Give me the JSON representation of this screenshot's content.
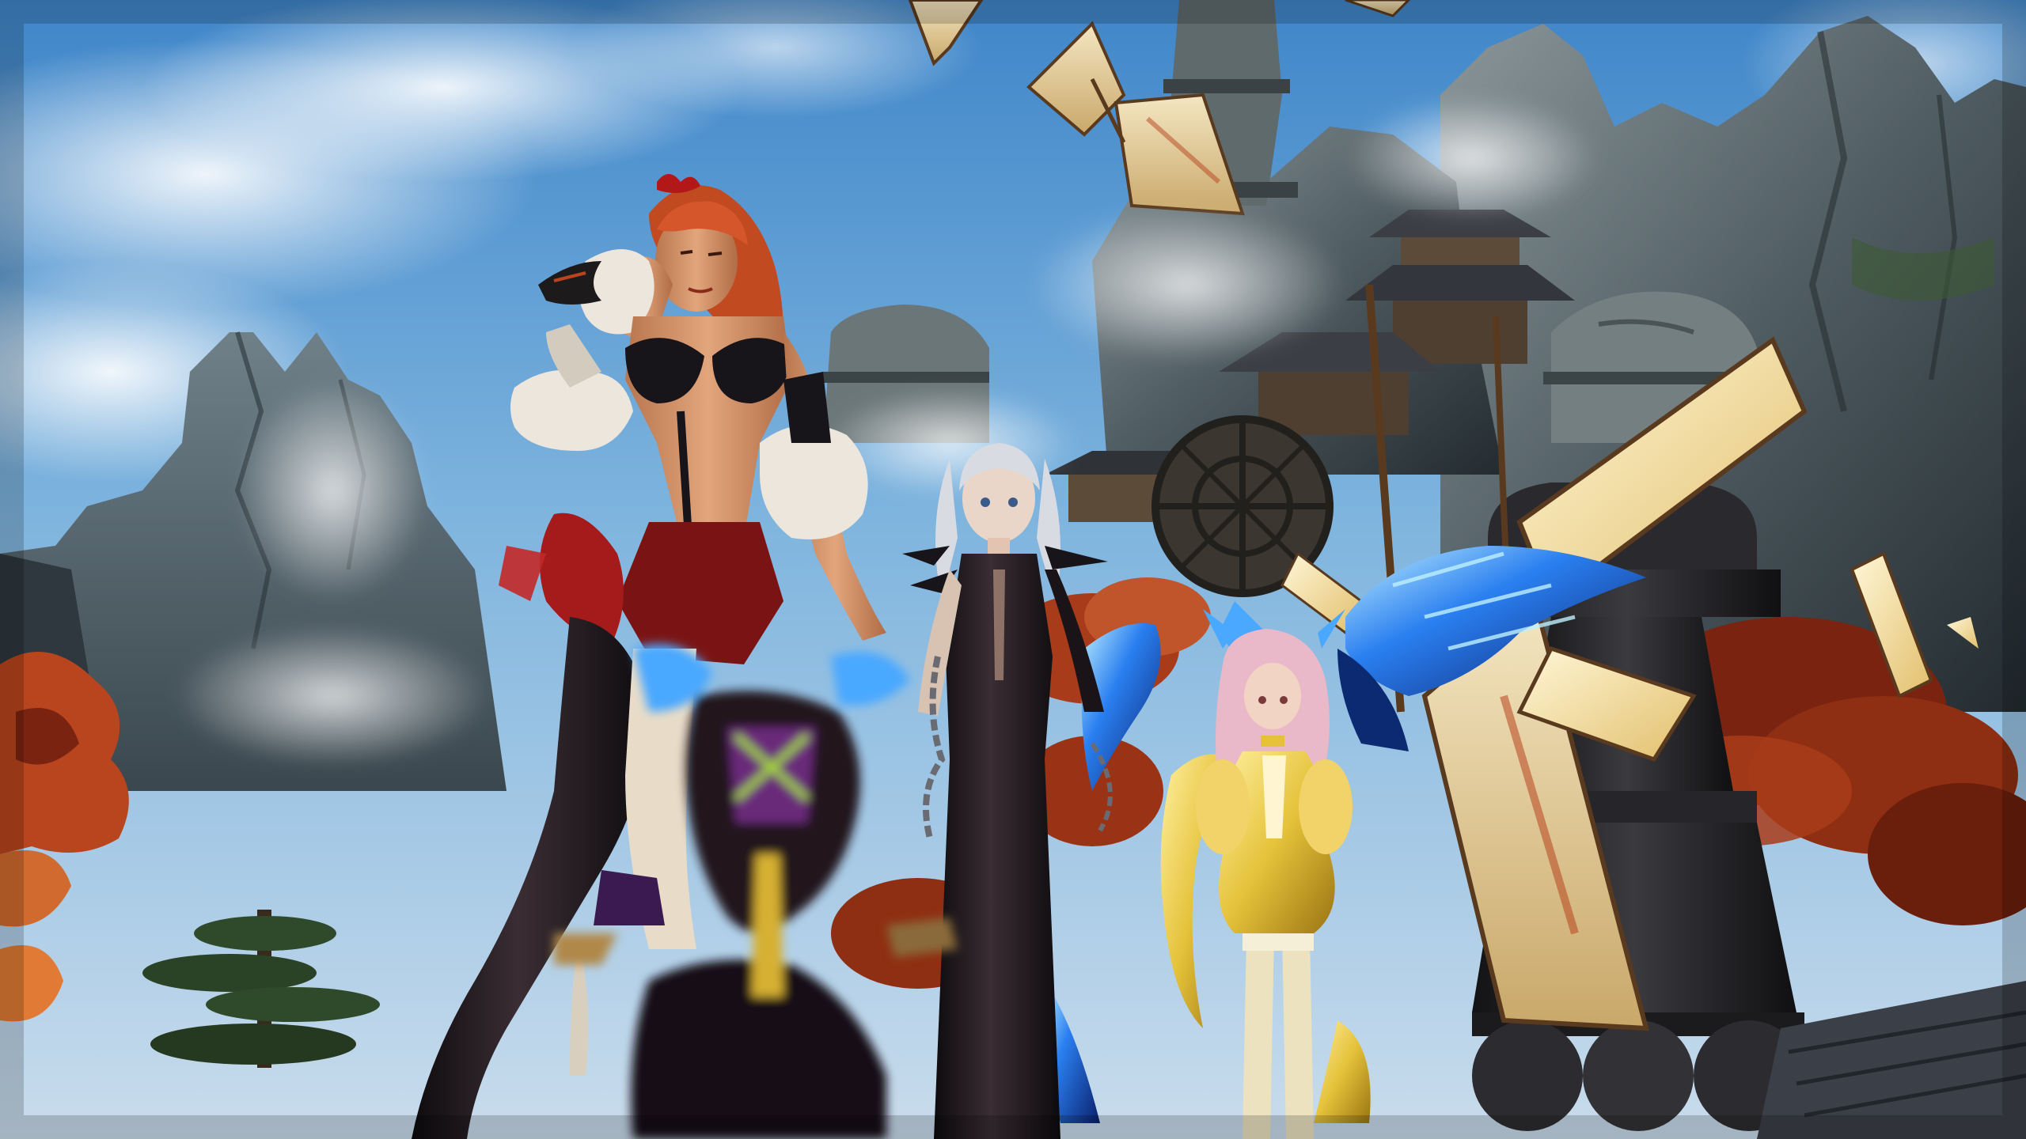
{
  "scene": {
    "elements": [
      "sky",
      "clouds",
      "rock-spires",
      "pagoda-fortress",
      "windmill-sails",
      "water-wheel",
      "mist",
      "autumn-trees",
      "pine-tree",
      "tiled-roofs",
      "character-redhead-tall",
      "character-silver-twintails",
      "character-pink-small",
      "character-blurred-foreground",
      "blue-crystal-wings"
    ]
  },
  "colors": {
    "sky_top": "#3f86c9",
    "sky_mid": "#7eb4de",
    "sky_low": "#c9dcec",
    "rock_dark": "#2f3a40",
    "rock_mid": "#4f5c62",
    "rock_light": "#7d8a8c",
    "foliage_autumn": "#b8451e",
    "foliage_autumn_deep": "#7a2310",
    "pine": "#2f4a2a",
    "sail_canvas": "#e7d6ae",
    "sail_dark": "#b89a62",
    "sail_glow": "#fff2c4",
    "wood": "#5a3a1e",
    "metal_dark": "#1f1f22",
    "redhead_hair": "#d4562a",
    "skin": "#d89a72",
    "outfit_black": "#17141a",
    "outfit_red": "#7a1414",
    "fur_white": "#ece6dc",
    "silver_hair": "#d9dbe2",
    "pink_hair": "#e9b9c9",
    "yellow_dress": "#e5c23a",
    "crystal_blue": "#2a7ff0",
    "crystal_bright": "#8fd6ff"
  }
}
